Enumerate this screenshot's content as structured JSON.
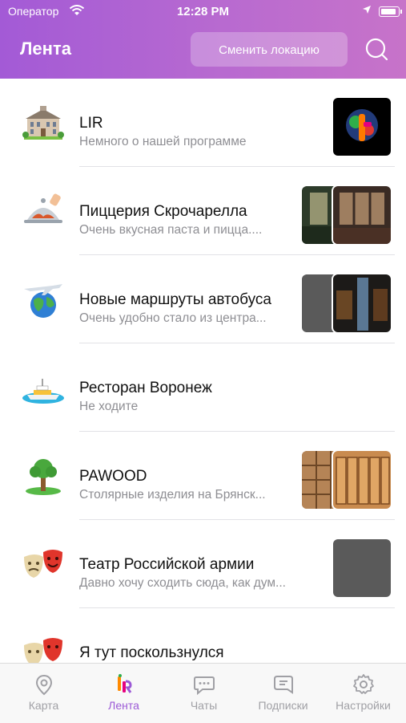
{
  "status_bar": {
    "carrier": "Оператор",
    "time": "12:28 PM"
  },
  "header": {
    "title": "Лента",
    "location_button": "Сменить локацию",
    "search_icon": "search-icon"
  },
  "feed": [
    {
      "title": "LIR",
      "subtitle": "Немного о нашей программе",
      "icon": "building-icon"
    },
    {
      "title": "Пиццерия Скрочарелла",
      "subtitle": "Очень вкусная паста и пицца....",
      "icon": "serving-dish-icon"
    },
    {
      "title": "Новые маршруты автобуса",
      "subtitle": "Очень удобно стало из центра...",
      "icon": "globe-plane-icon"
    },
    {
      "title": "Ресторан Воронеж",
      "subtitle": "Не ходите",
      "icon": "boat-icon"
    },
    {
      "title": "PAWOOD",
      "subtitle": "Столярные изделия на Брянск...",
      "icon": "tree-icon"
    },
    {
      "title": "Театр Российской армии",
      "subtitle": "Давно хочу сходить сюда, как дум...",
      "icon": "theater-masks-icon"
    },
    {
      "title": "Я тут поскользнулся",
      "subtitle": "",
      "icon": "theater-masks-icon"
    }
  ],
  "tabs": [
    {
      "label": "Карта",
      "icon": "map-pin-icon"
    },
    {
      "label": "Лента",
      "icon": "lir-logo-icon",
      "active": true
    },
    {
      "label": "Чаты",
      "icon": "chat-icon"
    },
    {
      "label": "Подписки",
      "icon": "subscriptions-icon"
    },
    {
      "label": "Настройки",
      "icon": "gear-icon"
    }
  ],
  "colors": {
    "header_start": "#a35ad6",
    "header_end": "#c773c9",
    "active_tab": "#9b59d6",
    "inactive_tab": "#a0a0a5"
  }
}
